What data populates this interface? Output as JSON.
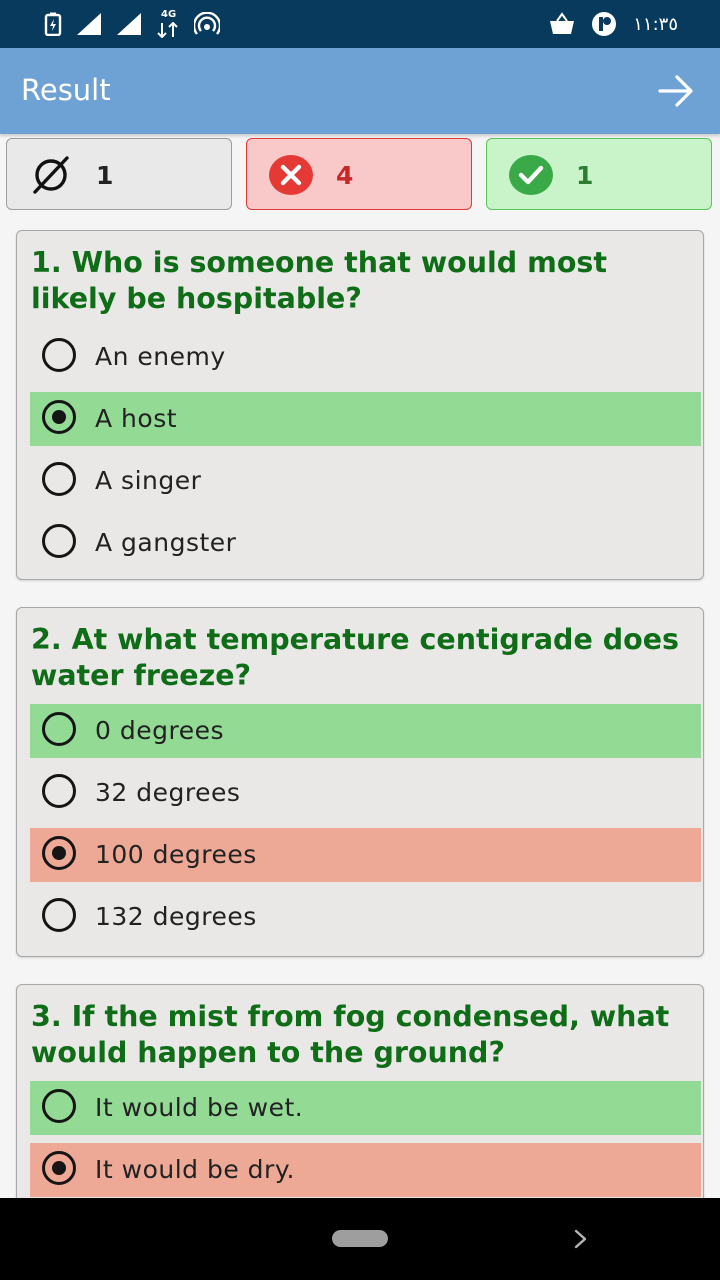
{
  "status_bar": {
    "time": "١١:٣٥",
    "network_label": "4G",
    "icons": [
      "battery-saver-icon",
      "signal-icon",
      "signal-icon",
      "data-arrows-icon",
      "hotspot-icon",
      "shopping-basket-icon",
      "app-notification-icon"
    ]
  },
  "app_bar": {
    "title": "Result",
    "next_icon": "arrow-right-icon"
  },
  "summary": {
    "unanswered": {
      "icon": "empty-set-icon",
      "count": "1"
    },
    "wrong": {
      "icon": "x-circle-icon",
      "count": "4",
      "color": "#e53935"
    },
    "correct": {
      "icon": "check-circle-icon",
      "count": "1",
      "color": "#3aa947"
    }
  },
  "colors": {
    "correct_highlight": "#93da95",
    "wrong_highlight": "#eea996",
    "question_text": "#0f6d17",
    "app_bar": "#6fa2d4",
    "status_bar": "#073a5c"
  },
  "questions": [
    {
      "text": "1. Who is someone that would most likely be hospitable?",
      "options": [
        {
          "label": "An enemy",
          "selected": false,
          "state": "none"
        },
        {
          "label": "A host",
          "selected": true,
          "state": "correct"
        },
        {
          "label": "A singer",
          "selected": false,
          "state": "none"
        },
        {
          "label": "A gangster",
          "selected": false,
          "state": "none"
        }
      ]
    },
    {
      "text": "2. At what temperature centigrade does water freeze?",
      "options": [
        {
          "label": "0 degrees",
          "selected": false,
          "state": "correct"
        },
        {
          "label": "32 degrees",
          "selected": false,
          "state": "none"
        },
        {
          "label": "100 degrees",
          "selected": true,
          "state": "wrong"
        },
        {
          "label": "132 degrees",
          "selected": false,
          "state": "none"
        }
      ]
    },
    {
      "text": "3. If the mist from fog condensed, what would happen to the ground?",
      "options": [
        {
          "label": "It would be wet.",
          "selected": false,
          "state": "correct"
        },
        {
          "label": "It would be dry.",
          "selected": true,
          "state": "wrong"
        }
      ]
    }
  ],
  "nav_bar": {
    "home_icon": "home-pill-icon",
    "forward_icon": "chevron-right-icon"
  }
}
